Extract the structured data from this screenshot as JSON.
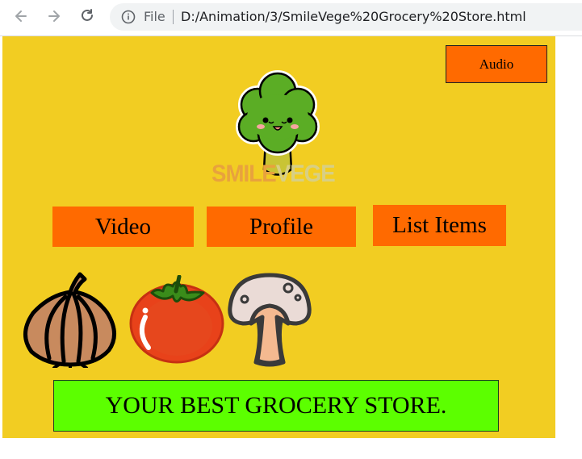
{
  "browser": {
    "file_label": "File",
    "url": "D:/Animation/3/SmileVege%20Grocery%20Store.html"
  },
  "page": {
    "audio_label": "Audio",
    "brand": {
      "part1": "SMILE",
      "part2": "VEGE"
    },
    "nav": [
      {
        "label": "Video"
      },
      {
        "label": "Profile"
      },
      {
        "label": "List Items"
      }
    ],
    "banner": "YOUR BEST GROCERY STORE."
  },
  "colors": {
    "page_bg": "#f2cd22",
    "button_orange": "#ff6a00",
    "banner_green": "#5cff00"
  },
  "icons": [
    "back-arrow-icon",
    "forward-arrow-icon",
    "reload-icon",
    "info-icon",
    "broccoli-mascot",
    "onion-icon",
    "tomato-icon",
    "mushroom-icon"
  ]
}
